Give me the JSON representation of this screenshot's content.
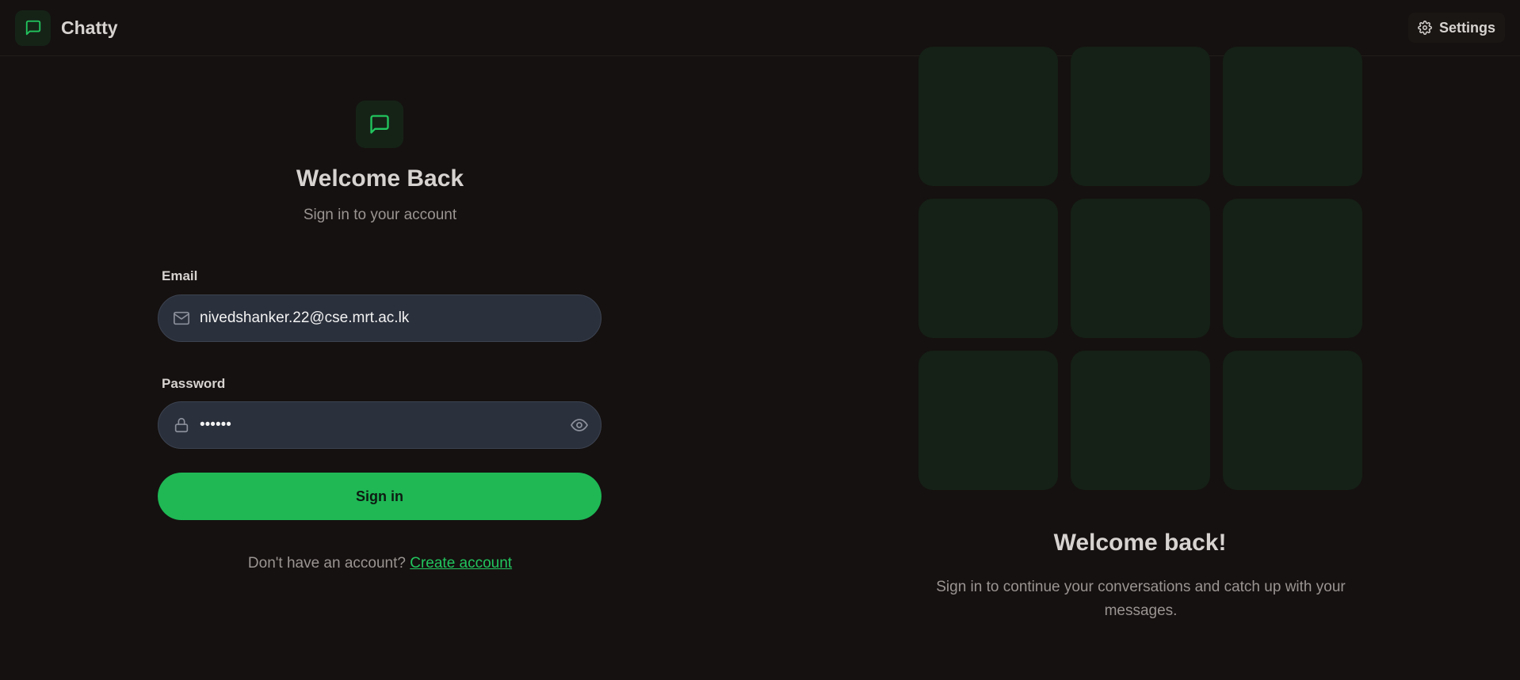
{
  "header": {
    "app_name": "Chatty",
    "settings_label": "Settings"
  },
  "login": {
    "title": "Welcome Back",
    "subtitle": "Sign in to your account",
    "email_label": "Email",
    "email_value": "nivedshanker.22@cse.mrt.ac.lk",
    "password_label": "Password",
    "password_value": "••••••",
    "signin_label": "Sign in",
    "signup_prompt": "Don't have an account?",
    "signup_link": "Create account"
  },
  "side_panel": {
    "title": "Welcome back!",
    "text": "Sign in to continue your conversations and catch up with your messages."
  },
  "icons": {
    "brand": "message-square-icon",
    "settings": "gear-icon",
    "email": "mail-icon",
    "password": "lock-icon",
    "toggle_password": "eye-icon"
  },
  "colors": {
    "background": "#151110",
    "accent": "#22c55e",
    "button": "#1fb855",
    "input_bg": "#2a303c",
    "tile": "#152016"
  }
}
